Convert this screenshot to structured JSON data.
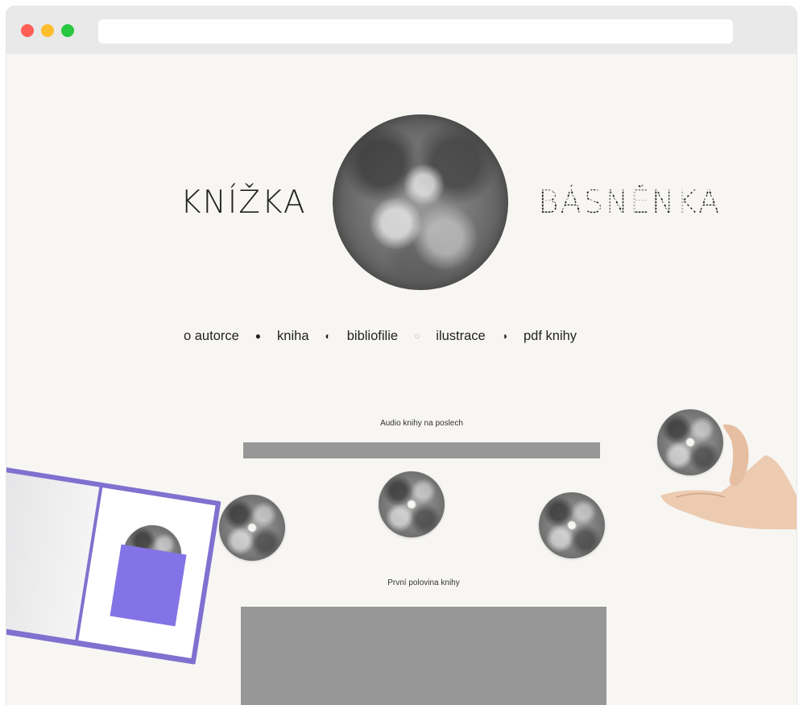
{
  "brand": {
    "left": "KNÍŽKA",
    "right": "BÁSNĚNKA"
  },
  "nav": {
    "items": [
      {
        "label": "o autorce"
      },
      {
        "label": "kniha"
      },
      {
        "label": "bibliofilie"
      },
      {
        "label": "ilustrace"
      },
      {
        "label": "pdf knihy"
      }
    ],
    "separators": [
      "●",
      "◐",
      "○",
      "◑"
    ]
  },
  "audio": {
    "title": "Audio knihy na poslech"
  },
  "half": {
    "title": "První polovina knihy"
  },
  "colors": {
    "background": "#f7f6f3",
    "player": "#979797",
    "book_accent": "#7f71cf"
  }
}
